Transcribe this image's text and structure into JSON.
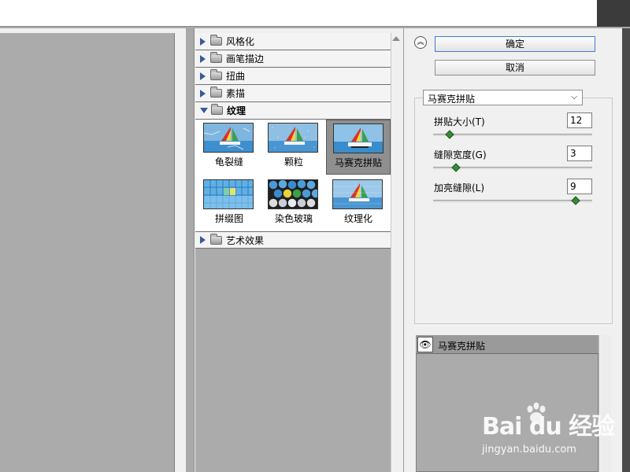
{
  "categories": [
    {
      "label": "风格化",
      "expanded": false
    },
    {
      "label": "画笔描边",
      "expanded": false
    },
    {
      "label": "扭曲",
      "expanded": false
    },
    {
      "label": "素描",
      "expanded": false
    },
    {
      "label": "纹理",
      "expanded": true
    },
    {
      "label": "艺术效果",
      "expanded": false
    }
  ],
  "texture_filters": [
    {
      "label": "龟裂缝",
      "selected": false
    },
    {
      "label": "颗粒",
      "selected": false
    },
    {
      "label": "马赛克拼贴",
      "selected": true
    },
    {
      "label": "拼缀图",
      "selected": false
    },
    {
      "label": "染色玻璃",
      "selected": false
    },
    {
      "label": "纹理化",
      "selected": false
    }
  ],
  "buttons": {
    "ok": "确定",
    "cancel": "取消"
  },
  "filter_select": {
    "value": "马赛克拼贴"
  },
  "params": [
    {
      "label": "拼贴大小(T)",
      "value": "12",
      "slider_fraction": 0.1
    },
    {
      "label": "缝隙宽度(G)",
      "value": "3",
      "slider_fraction": 0.14
    },
    {
      "label": "加亮缝隙(L)",
      "value": "9",
      "slider_fraction": 0.9
    }
  ],
  "layer": {
    "label": "马赛克拼贴",
    "icon": "eye-icon"
  },
  "watermark": {
    "logo": "Bai du 经验",
    "sub": "jingyan.baidu.com"
  },
  "colors": {
    "panel": "#f0f0f0",
    "canvas": "#ababab",
    "selected_thumb": "#8f8f8f",
    "slider_thumb": "#3a8a3a",
    "ok_border": "#3d7bd6"
  }
}
